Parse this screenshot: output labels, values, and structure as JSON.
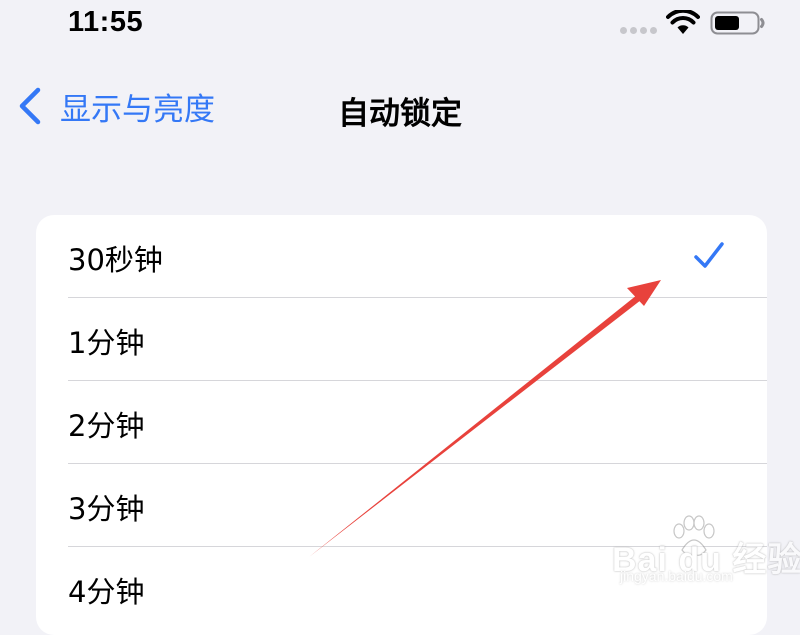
{
  "status_bar": {
    "time": "11:55",
    "icons": [
      "signal-dots-icon",
      "wifi-icon",
      "battery-icon"
    ],
    "battery_level": 0.6
  },
  "nav": {
    "back_label": "显示与亮度",
    "back_icon": "chevron-left-icon",
    "title": "自动锁定"
  },
  "options": [
    {
      "label": "30秒钟",
      "selected": true
    },
    {
      "label": "1分钟",
      "selected": false
    },
    {
      "label": "2分钟",
      "selected": false
    },
    {
      "label": "3分钟",
      "selected": false
    },
    {
      "label": "4分钟",
      "selected": false
    }
  ],
  "colors": {
    "background": "#f2f2f7",
    "card": "#ffffff",
    "accent": "#3478f6",
    "annotation": "#e8423c",
    "divider": "#d6d6da"
  },
  "watermark": {
    "brand": "Bai du 经验",
    "url": "jingyan.baidu.com"
  }
}
